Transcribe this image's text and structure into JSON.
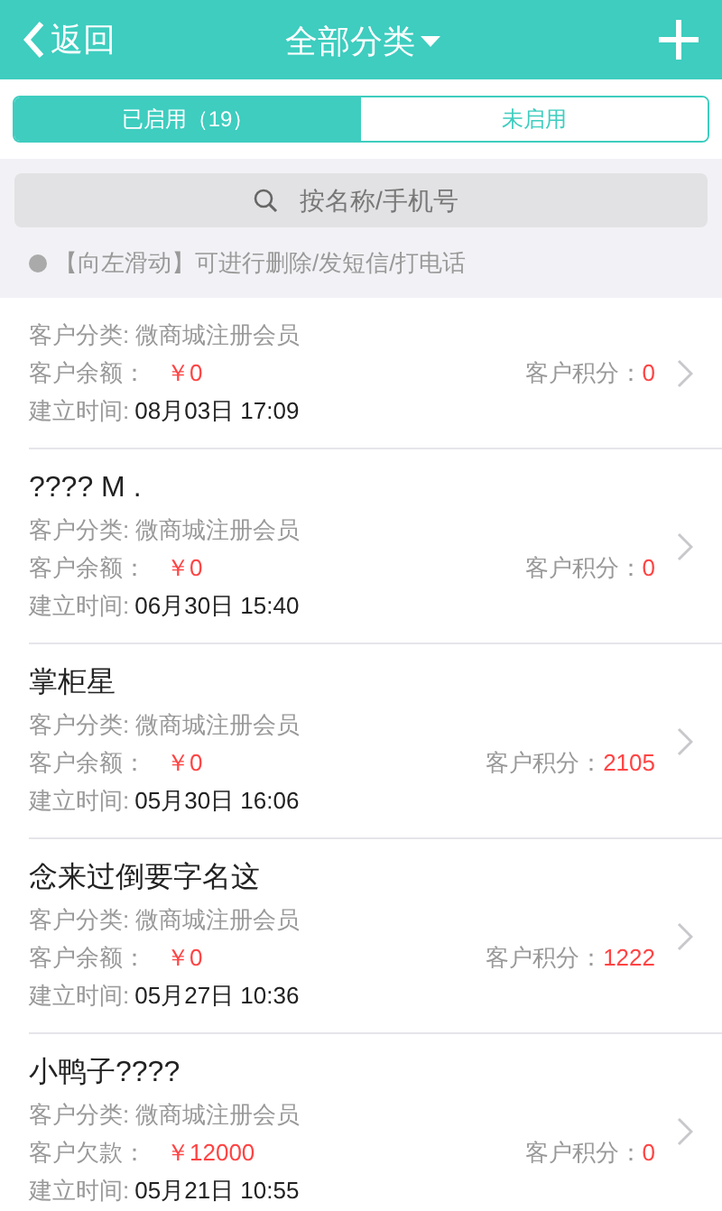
{
  "header": {
    "back": "返回",
    "title": "全部分类"
  },
  "tabs": [
    {
      "label": "已启用（19）",
      "selected": true
    },
    {
      "label": "未启用",
      "selected": false
    }
  ],
  "search": {
    "placeholder": "按名称/手机号"
  },
  "hint": "【向左滑动】可进行删除/发短信/打电话",
  "customers": [
    {
      "category": "客户分类: 微商城注册会员",
      "balance_label": "客户余额：",
      "balance": "￥0",
      "points_label": "客户积分：",
      "points": "0",
      "time_label": "建立时间:",
      "time": "08月03日 17:09"
    },
    {
      "name": "???? M .",
      "category": "客户分类: 微商城注册会员",
      "balance_label": "客户余额：",
      "balance": "￥0",
      "points_label": "客户积分：",
      "points": "0",
      "time_label": "建立时间:",
      "time": "06月30日 15:40"
    },
    {
      "name": "掌柜星",
      "category": "客户分类: 微商城注册会员",
      "balance_label": "客户余额：",
      "balance": "￥0",
      "points_label": "客户积分：",
      "points": "2105",
      "time_label": "建立时间:",
      "time": "05月30日 16:06"
    },
    {
      "name": "念来过倒要字名这",
      "category": "客户分类: 微商城注册会员",
      "balance_label": "客户余额：",
      "balance": "￥0",
      "points_label": "客户积分：",
      "points": "1222",
      "time_label": "建立时间:",
      "time": "05月27日 10:36"
    },
    {
      "name": "小鸭子????",
      "category": "客户分类: 微商城注册会员",
      "balance_label": "客户欠款：",
      "balance": "￥12000",
      "points_label": "客户积分：",
      "points": "0",
      "time_label": "建立时间:",
      "time": "05月21日 10:55"
    }
  ]
}
